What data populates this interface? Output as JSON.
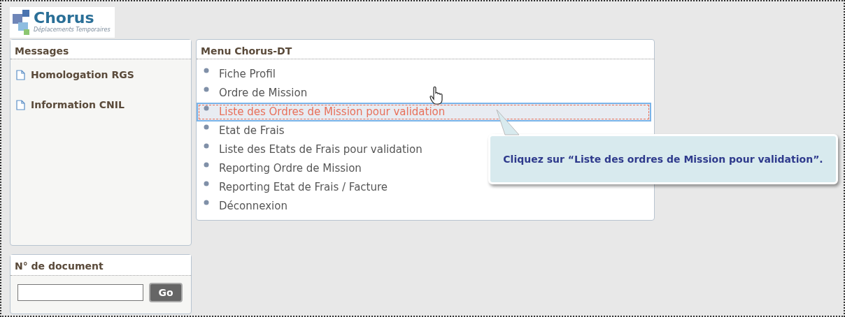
{
  "logo": {
    "name": "Chorus",
    "subtitle": "Déplacements Temporaires"
  },
  "messages": {
    "title": "Messages",
    "items": [
      "Homologation RGS",
      "Information CNIL"
    ]
  },
  "menu": {
    "title": "Menu Chorus-DT",
    "items": [
      {
        "label": "Fiche Profil",
        "selected": false
      },
      {
        "label": "Ordre de Mission",
        "selected": false
      },
      {
        "label": "Liste des Ordres de Mission pour validation",
        "selected": true
      },
      {
        "label": "Etat de Frais",
        "selected": false
      },
      {
        "label": "Liste des Etats de Frais pour validation",
        "selected": false
      },
      {
        "label": "Reporting Ordre de Mission",
        "selected": false
      },
      {
        "label": "Reporting Etat de Frais / Facture",
        "selected": false
      },
      {
        "label": "Déconnexion",
        "selected": false
      }
    ]
  },
  "document": {
    "title": "N° de document",
    "button": "Go"
  },
  "tooltip": {
    "text": "Cliquez sur “Liste des ordres de Mission pour validation”."
  }
}
